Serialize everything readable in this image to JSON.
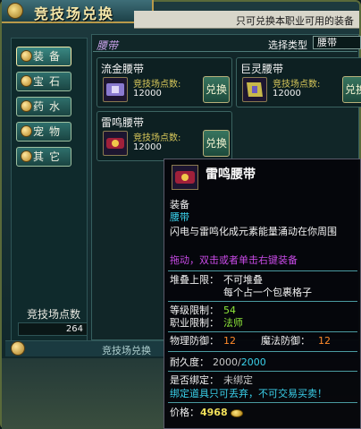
{
  "window": {
    "title": "竞技场兑换",
    "notice": "只可兑换本职业可用的装备"
  },
  "sidebar": {
    "items": [
      {
        "label": "装备",
        "active": true
      },
      {
        "label": "宝石",
        "active": false
      },
      {
        "label": "药水",
        "active": false
      },
      {
        "label": "宠物",
        "active": false
      },
      {
        "label": "其它",
        "active": false
      }
    ],
    "points_label": "竞技场点数",
    "points_value": "264"
  },
  "category": {
    "title": "腰带",
    "type_label": "选择类型",
    "type_value": "腰带"
  },
  "items": [
    {
      "name": "流金腰带",
      "pts_label": "竞技场点数:",
      "pts": "12000",
      "btn": "兑换",
      "icon": "belt-gold-icon"
    },
    {
      "name": "巨灵腰带",
      "pts_label": "竞技场点数:",
      "pts": "12000",
      "btn": "兑换",
      "icon": "belt-giant-icon"
    },
    {
      "name": "雷鸣腰带",
      "pts_label": "竞技场点数:",
      "pts": "12000",
      "btn": "兑换",
      "icon": "belt-thunder-icon"
    }
  ],
  "bottom_bar": {
    "text": "竞技场兑换"
  },
  "tooltip": {
    "title": "雷鸣腰带",
    "kind": "装备",
    "subkind": "腰带",
    "desc": "闪电与雷鸣化成元素能量涌动在你周围",
    "hint": "拖动，双击或者单击右键装备",
    "stack_label": "堆叠上限：",
    "stack_value1": "不可堆叠",
    "stack_value2": "每个占一个包裹格子",
    "level_label": "等级限制：",
    "level_value": "54",
    "class_label": "职业限制：",
    "class_value": "法师",
    "pdef_label": "物理防御：",
    "pdef_value": "12",
    "mdef_label": "魔法防御：",
    "mdef_value": "12",
    "dur_label": "耐久度：",
    "dur_cur": "2000",
    "dur_sep": "/",
    "dur_max": "2000",
    "bind_label": "是否绑定：",
    "bind_value": "未绑定",
    "bind_note": "绑定道具只可丢弃，不可交易买卖！",
    "price_label": "价格：",
    "price_value": "4968"
  },
  "colors": {
    "accent_gold": "#f4e6a8",
    "tooltip_green": "#8fe83a",
    "tooltip_cyan": "#3ad0ea",
    "tooltip_purple": "#c84ae6"
  }
}
